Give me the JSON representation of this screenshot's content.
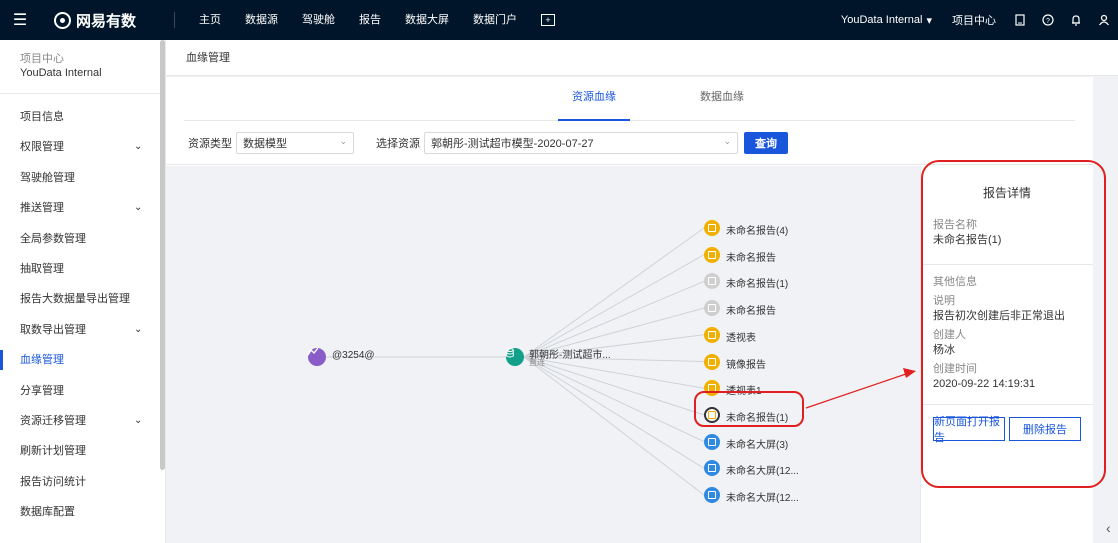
{
  "topbar": {
    "menu_icon": "menu-icon",
    "brand": "网易有数",
    "nav": [
      "主页",
      "数据源",
      "驾驶舱",
      "报告",
      "数据大屏",
      "数据门户"
    ],
    "user": "YouData Internal",
    "project_center": "项目中心"
  },
  "sidebar": {
    "project_label": "项目中心",
    "project_name": "YouData Internal",
    "items": [
      {
        "label": "项目信息",
        "expandable": false
      },
      {
        "label": "权限管理",
        "expandable": true
      },
      {
        "label": "驾驶舱管理",
        "expandable": false
      },
      {
        "label": "推送管理",
        "expandable": true
      },
      {
        "label": "全局参数管理",
        "expandable": false
      },
      {
        "label": "抽取管理",
        "expandable": false
      },
      {
        "label": "报告大数据量导出管理",
        "expandable": false
      },
      {
        "label": "取数导出管理",
        "expandable": true
      },
      {
        "label": "血缘管理",
        "expandable": false,
        "active": true
      },
      {
        "label": "分享管理",
        "expandable": false
      },
      {
        "label": "资源迁移管理",
        "expandable": true
      },
      {
        "label": "刷新计划管理",
        "expandable": false
      },
      {
        "label": "报告访问统计",
        "expandable": false
      },
      {
        "label": "数据库配置",
        "expandable": false
      }
    ]
  },
  "page": {
    "title": "血缘管理",
    "tabs": [
      "资源血缘",
      "数据血缘"
    ],
    "active_tab": 0
  },
  "filter": {
    "type_label": "资源类型",
    "type_value": "数据模型",
    "resource_label": "选择资源",
    "resource_value": "郭朝彤-测试超市模型-2020-07-27",
    "query_button": "查询"
  },
  "graph": {
    "source": {
      "label": "@3254@",
      "icon": "flow-icon",
      "color": "#8a5cc7"
    },
    "center": {
      "label": "郭朝彤-测试超市...",
      "sublabel": "直连",
      "icon": "database-icon",
      "color": "#13a08a"
    },
    "targets": [
      {
        "label": "未命名报告(4)",
        "kind": "report",
        "color": "yellow"
      },
      {
        "label": "未命名报告",
        "kind": "report",
        "color": "yellow"
      },
      {
        "label": "未命名报告(1)",
        "kind": "report",
        "color": "gray"
      },
      {
        "label": "未命名报告",
        "kind": "report",
        "color": "gray"
      },
      {
        "label": "透视表",
        "kind": "report",
        "color": "yellow"
      },
      {
        "label": "镜像报告",
        "kind": "report",
        "color": "yellow"
      },
      {
        "label": "透视表1",
        "kind": "report",
        "color": "yellow"
      },
      {
        "label": "未命名报告(1)",
        "kind": "report",
        "color": "yellow-selected"
      },
      {
        "label": "未命名大屏(3)",
        "kind": "screen",
        "color": "blue"
      },
      {
        "label": "未命名大屏(12...",
        "kind": "screen",
        "color": "blue"
      },
      {
        "label": "未命名大屏(12...",
        "kind": "screen",
        "color": "blue"
      }
    ]
  },
  "detail": {
    "title": "报告详情",
    "name_key": "报告名称",
    "name_value": "未命名报告(1)",
    "other_info": "其他信息",
    "desc_key": "说明",
    "desc_value": "报告初次创建后非正常退出",
    "creator_key": "创建人",
    "creator_value": "杨冰",
    "created_key": "创建时间",
    "created_value": "2020-09-22 14:19:31",
    "open_button": "新页面打开报告",
    "delete_button": "删除报告"
  },
  "colors": {
    "accent": "#1a56db",
    "topbar": "#001529",
    "highlight": "#e02020"
  }
}
